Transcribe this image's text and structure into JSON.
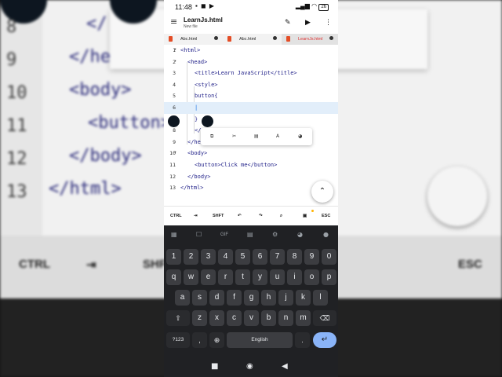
{
  "status": {
    "time": "11:48",
    "battery": "26"
  },
  "app": {
    "title": "LearnJs.html",
    "subtitle": "New file",
    "menu_icon": "hamburger-menu-icon",
    "edit_icon": "pencil-icon",
    "run_icon": "play-icon",
    "more_icon": "more-vert-icon"
  },
  "tabs": [
    {
      "label": "Abc.html",
      "active": false
    },
    {
      "label": "Abc.html",
      "active": false
    },
    {
      "label": "LearnJs.html",
      "active": true
    }
  ],
  "editor": {
    "lines": [
      {
        "num": "1",
        "fold": true,
        "text": "<html>"
      },
      {
        "num": "2",
        "fold": true,
        "text": "<head>"
      },
      {
        "num": "3",
        "fold": false,
        "text": "<title>Learn JavaScript</title>"
      },
      {
        "num": "4",
        "fold": false,
        "text": "<style>"
      },
      {
        "num": "5",
        "fold": false,
        "text": "button{"
      },
      {
        "num": "6",
        "fold": false,
        "text": "|"
      },
      {
        "num": "7",
        "fold": false,
        "text": "}"
      },
      {
        "num": "8",
        "fold": false,
        "text": "</"
      },
      {
        "num": "9",
        "fold": false,
        "text": "</he"
      },
      {
        "num": "10",
        "fold": true,
        "text": "<body>"
      },
      {
        "num": "11",
        "fold": false,
        "text": "<button>Click me</button>"
      },
      {
        "num": "12",
        "fold": false,
        "text": "</body>"
      },
      {
        "num": "13",
        "fold": false,
        "text": "</html>"
      }
    ]
  },
  "selection_menu": [
    "copy-icon",
    "cut-icon",
    "paste-icon",
    "format-icon",
    "palette-icon"
  ],
  "extra_keys": [
    "CTRL",
    "⇥",
    "SHFT",
    "↶",
    "↷",
    "⌕",
    "save-icon",
    "ESC"
  ],
  "keyboard": {
    "toolbar": [
      "apps-grid-icon",
      "sticker-icon",
      "GIF",
      "clipboard-icon",
      "settings-icon",
      "palette-icon",
      "mic-icon"
    ],
    "row1": [
      "1",
      "2",
      "3",
      "4",
      "5",
      "6",
      "7",
      "8",
      "9",
      "0"
    ],
    "row2": [
      "q",
      "w",
      "e",
      "r",
      "t",
      "y",
      "u",
      "i",
      "o",
      "p"
    ],
    "row3": [
      "a",
      "s",
      "d",
      "f",
      "g",
      "h",
      "j",
      "k",
      "l"
    ],
    "row4": [
      "z",
      "x",
      "c",
      "v",
      "b",
      "n",
      "m"
    ],
    "symbols": "?123",
    "comma": ",",
    "space": "English",
    "period": "."
  },
  "background": {
    "line_numbers": [
      "8",
      "9",
      "10",
      "11",
      "12",
      "13"
    ],
    "code": [
      "</",
      "</he",
      "<body>",
      "<button>",
      "</body>",
      "</html>"
    ],
    "strip": [
      "CTRL",
      "⇥",
      "SHF",
      "ESC"
    ]
  }
}
